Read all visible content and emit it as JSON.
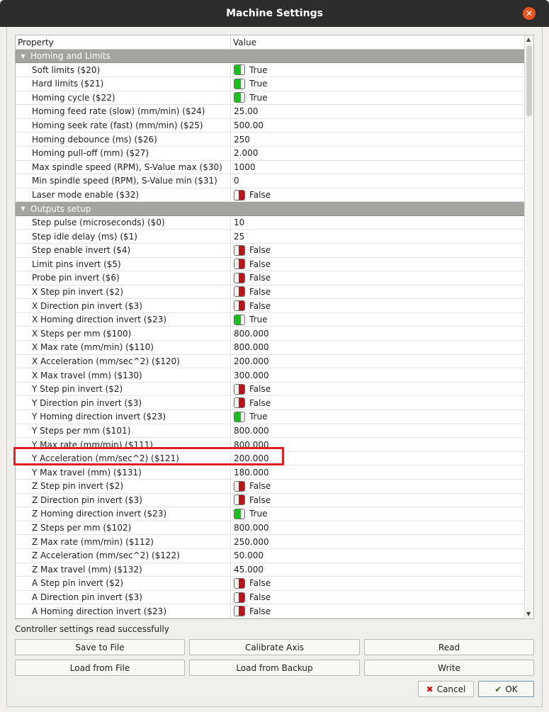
{
  "window": {
    "title": "Machine Settings"
  },
  "tree": {
    "headers": {
      "property": "Property",
      "value": "Value"
    },
    "rows": [
      {
        "kind": "group",
        "label": "Homing and Limits"
      },
      {
        "kind": "item",
        "property": "Soft limits ($20)",
        "value": "True",
        "toggle": "on"
      },
      {
        "kind": "item",
        "property": "Hard limits ($21)",
        "value": "True",
        "toggle": "on"
      },
      {
        "kind": "item",
        "property": "Homing cycle ($22)",
        "value": "True",
        "toggle": "on"
      },
      {
        "kind": "item",
        "property": "Homing feed rate (slow) (mm/min) ($24)",
        "value": "25.00"
      },
      {
        "kind": "item",
        "property": "Homing seek rate (fast) (mm/min) ($25)",
        "value": "500.00"
      },
      {
        "kind": "item",
        "property": "Homing debounce (ms) ($26)",
        "value": "250"
      },
      {
        "kind": "item",
        "property": "Homing pull-off (mm) ($27)",
        "value": "2.000"
      },
      {
        "kind": "item",
        "property": "Max spindle speed (RPM), S-Value max ($30)",
        "value": "1000"
      },
      {
        "kind": "item",
        "property": "Min spindle speed (RPM), S-Value min ($31)",
        "value": "0"
      },
      {
        "kind": "item",
        "property": "Laser mode enable ($32)",
        "value": "False",
        "toggle": "off"
      },
      {
        "kind": "group",
        "label": "Outputs setup"
      },
      {
        "kind": "item",
        "property": "Step pulse (microseconds) ($0)",
        "value": "10"
      },
      {
        "kind": "item",
        "property": "Step idle delay (ms) ($1)",
        "value": "25"
      },
      {
        "kind": "item",
        "property": "Step enable invert ($4)",
        "value": "False",
        "toggle": "off"
      },
      {
        "kind": "item",
        "property": "Limit pins invert ($5)",
        "value": "False",
        "toggle": "off"
      },
      {
        "kind": "item",
        "property": "Probe pin invert ($6)",
        "value": "False",
        "toggle": "off"
      },
      {
        "kind": "item",
        "property": "X Step pin invert ($2)",
        "value": "False",
        "toggle": "off"
      },
      {
        "kind": "item",
        "property": "X Direction pin invert ($3)",
        "value": "False",
        "toggle": "off"
      },
      {
        "kind": "item",
        "property": "X Homing direction invert ($23)",
        "value": "True",
        "toggle": "on"
      },
      {
        "kind": "item",
        "property": "X Steps per mm ($100)",
        "value": "800.000"
      },
      {
        "kind": "item",
        "property": "X Max rate (mm/min) ($110)",
        "value": "800.000"
      },
      {
        "kind": "item",
        "property": "X Acceleration (mm/sec^2) ($120)",
        "value": "200.000"
      },
      {
        "kind": "item",
        "property": "X Max travel (mm) ($130)",
        "value": "300.000"
      },
      {
        "kind": "item",
        "property": "Y Step pin invert ($2)",
        "value": "False",
        "toggle": "off"
      },
      {
        "kind": "item",
        "property": "Y Direction pin invert ($3)",
        "value": "False",
        "toggle": "off"
      },
      {
        "kind": "item",
        "property": "Y Homing direction invert ($23)",
        "value": "True",
        "toggle": "on"
      },
      {
        "kind": "item",
        "property": "Y Steps per mm ($101)",
        "value": "800.000"
      },
      {
        "kind": "item",
        "property": "Y Max rate (mm/min) ($111)",
        "value": "800.000"
      },
      {
        "kind": "item",
        "property": "Y Acceleration (mm/sec^2) ($121)",
        "value": "200.000"
      },
      {
        "kind": "item",
        "property": "Y Max travel (mm) ($131)",
        "value": "180.000"
      },
      {
        "kind": "item",
        "property": "Z Step pin invert ($2)",
        "value": "False",
        "toggle": "off"
      },
      {
        "kind": "item",
        "property": "Z Direction pin invert ($3)",
        "value": "False",
        "toggle": "off"
      },
      {
        "kind": "item",
        "property": "Z Homing direction invert ($23)",
        "value": "True",
        "toggle": "on"
      },
      {
        "kind": "item",
        "property": "Z Steps per mm ($102)",
        "value": "800.000"
      },
      {
        "kind": "item",
        "property": "Z Max rate (mm/min) ($112)",
        "value": "250.000"
      },
      {
        "kind": "item",
        "property": "Z Acceleration (mm/sec^2) ($122)",
        "value": "50.000"
      },
      {
        "kind": "item",
        "property": "Z Max travel (mm) ($132)",
        "value": "45.000"
      },
      {
        "kind": "item",
        "property": "A Step pin invert ($2)",
        "value": "False",
        "toggle": "off"
      },
      {
        "kind": "item",
        "property": "A Direction pin invert ($3)",
        "value": "False",
        "toggle": "off"
      },
      {
        "kind": "item",
        "property": "A Homing direction invert ($23)",
        "value": "False",
        "toggle": "off"
      }
    ]
  },
  "status": "Controller settings read successfully",
  "buttons": {
    "save_to_file": "Save to File",
    "calibrate_axis": "Calibrate Axis",
    "read": "Read",
    "load_from_file": "Load from File",
    "load_from_backup": "Load from Backup",
    "write": "Write",
    "cancel": "Cancel",
    "ok": "OK"
  },
  "icons": {
    "close": "close-icon",
    "group_expander": "triangle-down-icon",
    "cancel": "x-icon",
    "ok": "check-icon"
  },
  "colors": {
    "toggle_on": "#17c21a",
    "toggle_off": "#b6161a",
    "group_header": "#a3a3a1",
    "highlight_box": "#e02020",
    "close_button": "#e95420"
  }
}
